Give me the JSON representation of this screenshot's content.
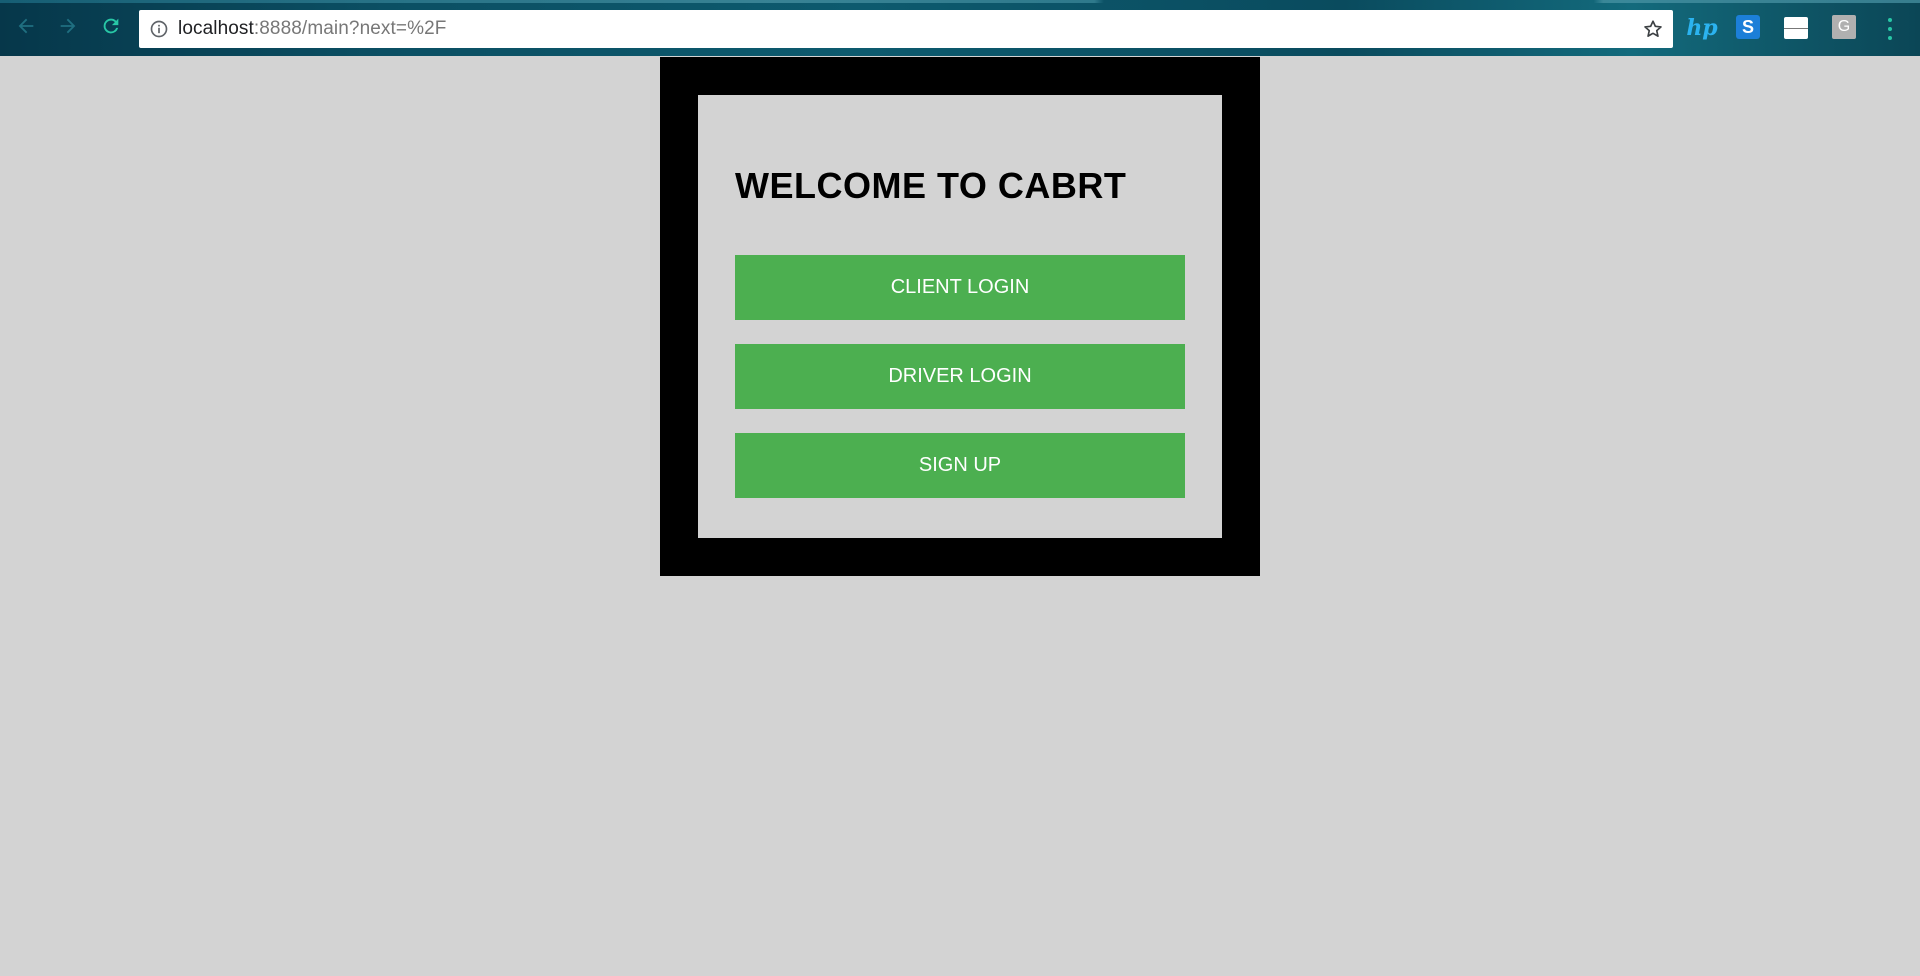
{
  "browser": {
    "url_host": "localhost",
    "url_rest": ":8888/main?next=%2F",
    "icons": {
      "back": "back-arrow-icon",
      "forward": "forward-arrow-icon",
      "reload": "reload-icon",
      "info": "info-icon",
      "bookmark": "star-icon",
      "menu": "kebab-menu-icon"
    },
    "extensions": {
      "hp_label": "hp",
      "s_label": "S",
      "g_label": "G"
    },
    "colors": {
      "toolbar": "#0b4f63",
      "accent": "#28c7a6"
    }
  },
  "page": {
    "title": "WELCOME TO CABRT",
    "buttons": {
      "client_login": "CLIENT LOGIN",
      "driver_login": "DRIVER LOGIN",
      "sign_up": "SIGN UP"
    },
    "colors": {
      "background": "#d3d3d3",
      "frame": "#000000",
      "button": "#4caf50",
      "button_text": "#ffffff"
    }
  }
}
